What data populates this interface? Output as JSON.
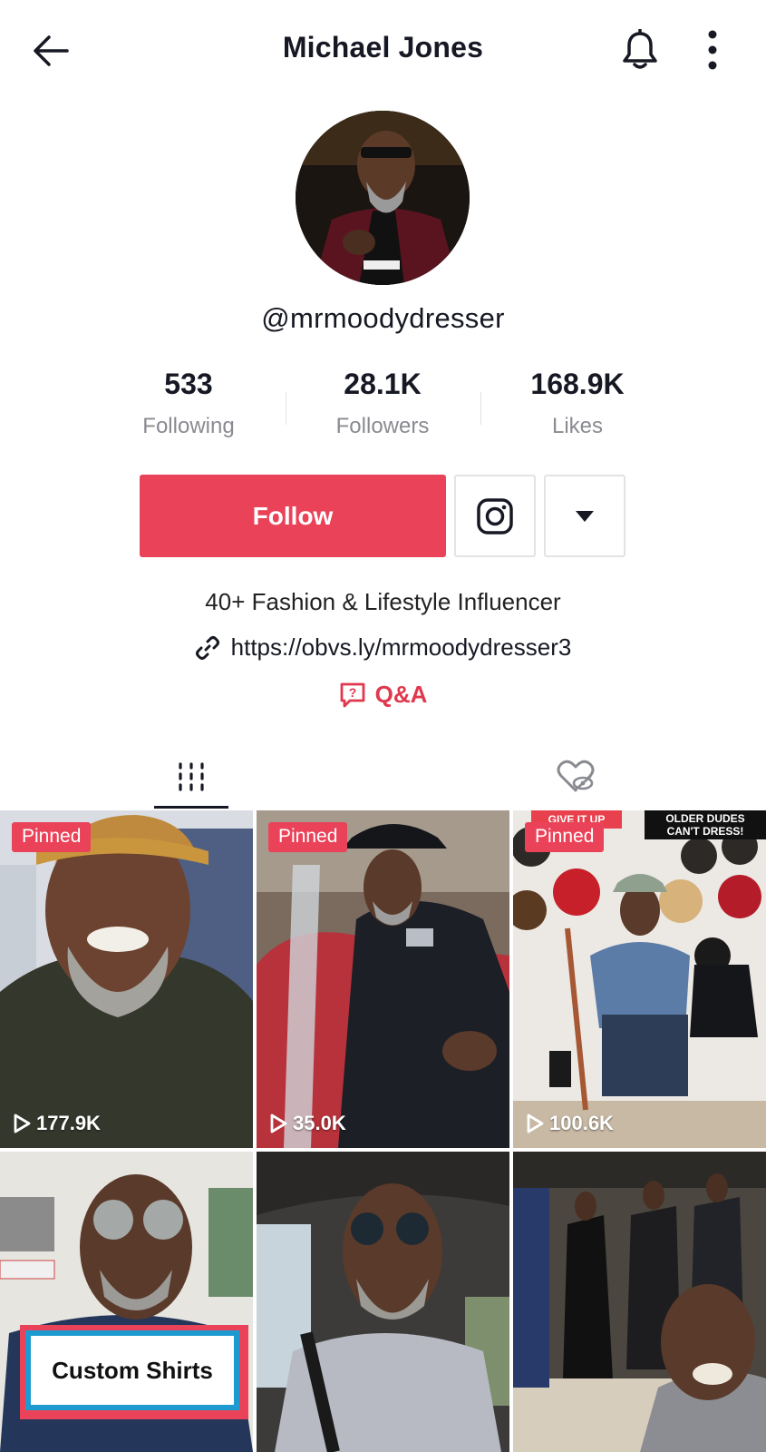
{
  "header": {
    "title": "Michael Jones"
  },
  "profile": {
    "handle": "@mrmoodydresser",
    "stats": [
      {
        "value": "533",
        "label": "Following"
      },
      {
        "value": "28.1K",
        "label": "Followers"
      },
      {
        "value": "168.9K",
        "label": "Likes"
      }
    ],
    "follow_label": "Follow",
    "bio": "40+ Fashion & Lifestyle Influencer",
    "link": "https://obvs.ly/mrmoodydresser3",
    "qa_label": "Q&A"
  },
  "icons": {
    "back": "arrow-left-icon",
    "bell": "bell-icon",
    "more": "more-vertical-icon",
    "instagram": "instagram-icon",
    "dropdown": "caret-down-icon",
    "link": "link-icon",
    "qa": "question-bubble-icon",
    "videos_tab": "grid-bars-icon",
    "liked_tab": "hidden-heart-icon",
    "play": "play-outline-icon"
  },
  "colors": {
    "accent": "#ea4359",
    "text": "#161823",
    "muted": "#8a8b91"
  },
  "videos": [
    {
      "pinned": "Pinned",
      "views": "177.9K"
    },
    {
      "pinned": "Pinned",
      "views": "35.0K"
    },
    {
      "pinned": "Pinned",
      "views": "100.6K",
      "banner_left": "GIVE IT UP",
      "banner_right_1": "OLDER DUDES",
      "banner_right_2": "CAN'T DRESS!"
    },
    {
      "caption": "Custom Shirts"
    },
    {},
    {}
  ]
}
